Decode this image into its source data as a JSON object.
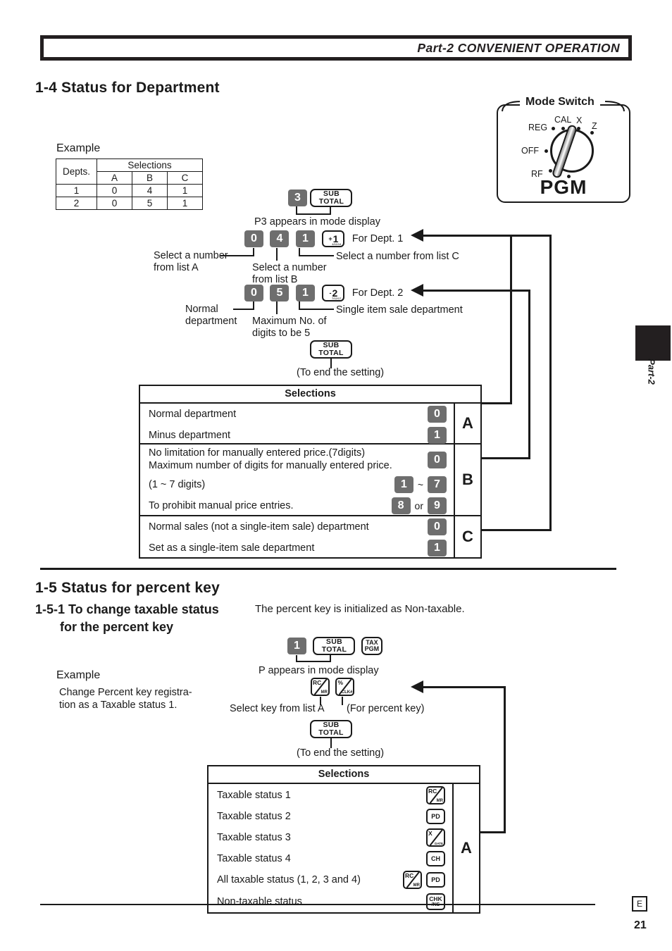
{
  "header": {
    "title": "Part-2 CONVENIENT OPERATION"
  },
  "mode_switch": {
    "label": "Mode Switch",
    "positions": [
      "REG",
      "CAL",
      "X",
      "Z",
      "OFF",
      "RF"
    ],
    "selected": "PGM"
  },
  "side_tab": {
    "label": "Part-2"
  },
  "footer": {
    "mark": "E",
    "page": "21"
  },
  "section_14": {
    "heading": "1-4  Status for Department",
    "example_label": "Example",
    "example_table": {
      "col_depts": "Depts.",
      "col_group": "Selections",
      "sub_cols": [
        "A",
        "B",
        "C"
      ],
      "rows": [
        {
          "dept": "1",
          "a": "0",
          "b": "4",
          "c": "1"
        },
        {
          "dept": "2",
          "a": "0",
          "b": "5",
          "c": "1"
        }
      ]
    },
    "flow": {
      "step1_keys": {
        "num": "3",
        "fn_line1": "SUB",
        "fn_line2": "TOTAL"
      },
      "step1_note": "P3 appears in mode display",
      "dept1": {
        "keys": [
          "0",
          "4",
          "1"
        ],
        "dept_key_plus": "+",
        "dept_key_num": "1",
        "dept_key_sub": "4/11/14",
        "label": "For Dept. 1"
      },
      "dept2": {
        "keys": [
          "0",
          "5",
          "1"
        ],
        "dept_key_plus": "-",
        "dept_key_num": "2",
        "dept_key_sub": "7/12/17",
        "label": "For Dept. 2"
      },
      "callout_list_a": "Select a number\nfrom list A",
      "callout_list_a_l1": "Select a number",
      "callout_list_a_l2": "from list A",
      "callout_list_b_l1": "Select a number",
      "callout_list_b_l2": "from list B",
      "callout_list_c": "Select a number from list C",
      "callout_normal_l1": "Normal",
      "callout_normal_l2": "department",
      "callout_max_l1": "Maximum No. of",
      "callout_max_l2": "digits to be 5",
      "callout_single": "Single item sale department",
      "end_key_line1": "SUB",
      "end_key_line2": "TOTAL",
      "end_note": "(To end the setting)"
    },
    "selections": {
      "title": "Selections",
      "groups": [
        {
          "letter": "A",
          "rows": [
            {
              "text": "Normal department",
              "keys": [
                {
                  "type": "num",
                  "v": "0"
                }
              ]
            },
            {
              "text": "Minus department",
              "keys": [
                {
                  "type": "num",
                  "v": "1"
                }
              ]
            }
          ]
        },
        {
          "letter": "B",
          "rows": [
            {
              "text": "No limitation for manually entered price.(7digits)",
              "keys": []
            },
            {
              "text": "Maximum number of digits for manually entered price.",
              "keys": [
                {
                  "type": "num",
                  "v": "0"
                }
              ]
            },
            {
              "text": "(1 ~ 7 digits)",
              "keys": [
                {
                  "type": "num",
                  "v": "1"
                },
                {
                  "type": "sep",
                  "v": "~"
                },
                {
                  "type": "num",
                  "v": "7"
                }
              ]
            },
            {
              "text": "To prohibit manual price entries.",
              "keys": [
                {
                  "type": "num",
                  "v": "8"
                },
                {
                  "type": "sep",
                  "v": "or"
                },
                {
                  "type": "num",
                  "v": "9"
                }
              ]
            }
          ]
        },
        {
          "letter": "C",
          "rows": [
            {
              "text": "Normal sales (not a single-item sale) department",
              "keys": [
                {
                  "type": "num",
                  "v": "0"
                }
              ]
            },
            {
              "text": "Set as a single-item sale department",
              "keys": [
                {
                  "type": "num",
                  "v": "1"
                }
              ]
            }
          ]
        }
      ]
    }
  },
  "section_15": {
    "heading": "1-5  Status for percent key",
    "sub_heading": "1-5-1  To change taxable status",
    "sub_heading_line2": "for the percent key",
    "note": "The percent key is initialized as Non-taxable.",
    "example_label": "Example",
    "example_text_l1": "Change Percent key registra-",
    "example_text_l2": "tion as a Taxable status 1.",
    "flow": {
      "step1_num": "1",
      "step1_sub_l1": "SUB",
      "step1_sub_l2": "TOTAL",
      "step1_tax_l1": "TAX",
      "step1_tax_l2": "PGM",
      "step1_note": "P appears in mode display",
      "key_rc_tl": "RC",
      "key_rc_br": "MR",
      "key_pct_tl": "%",
      "key_pct_br": "CLK#",
      "callout_select": "Select key from list A",
      "callout_percent": "(For percent key)",
      "end_key_l1": "SUB",
      "end_key_l2": "TOTAL",
      "end_note": "(To end the setting)"
    },
    "selections": {
      "title": "Selections",
      "letter": "A",
      "rows": [
        {
          "text": "Taxable status 1",
          "keys": [
            {
              "type": "slash",
              "tl": "RC",
              "br": "MR"
            }
          ]
        },
        {
          "text": "Taxable status 2",
          "keys": [
            {
              "type": "plain",
              "v": "PD"
            }
          ]
        },
        {
          "text": "Taxable status 3",
          "keys": [
            {
              "type": "slash",
              "tl": "X",
              "br": "DATE"
            }
          ]
        },
        {
          "text": "Taxable status 4",
          "keys": [
            {
              "type": "plain",
              "v": "CH"
            }
          ]
        },
        {
          "text": "All taxable status (1, 2, 3 and 4)",
          "keys": [
            {
              "type": "slash",
              "tl": "RC",
              "br": "MR"
            },
            {
              "type": "plain",
              "v": "PD"
            }
          ]
        },
        {
          "text": "Non-taxable status",
          "keys": [
            {
              "type": "two",
              "l1": "CHK",
              "l2": "/NS"
            }
          ]
        }
      ]
    }
  }
}
